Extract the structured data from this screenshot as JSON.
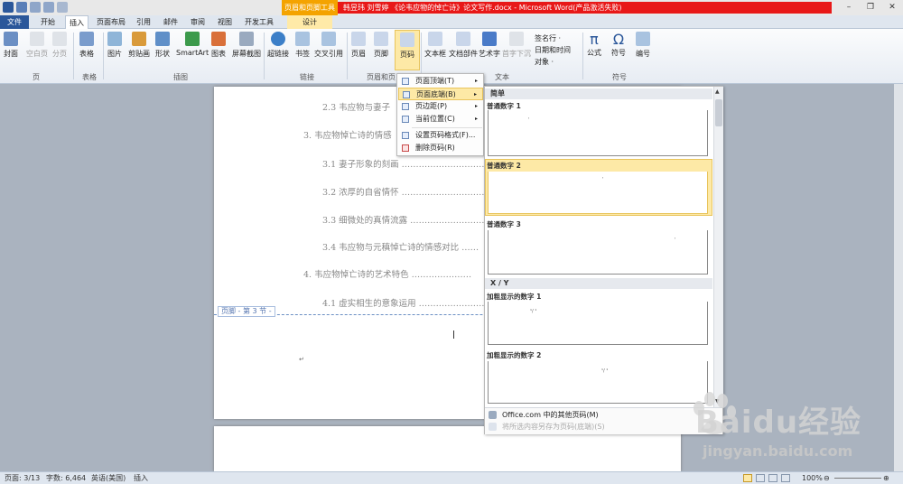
{
  "window": {
    "context_tab": "页眉和页脚工具",
    "title": "韩昱玮 刘雪婷 《论韦应物的悼亡诗》论文写作.docx - Microsoft Word(产品激活失败)"
  },
  "tabs": [
    "文件",
    "开始",
    "插入",
    "页面布局",
    "引用",
    "邮件",
    "审阅",
    "视图",
    "开发工具",
    "设计"
  ],
  "ribbon": {
    "cover": "封面",
    "blank": "空白页",
    "break": "分页",
    "table": "表格",
    "picture": "图片",
    "clipart": "剪贴画",
    "shapes": "形状",
    "smartart": "SmartArt",
    "chart": "图表",
    "screenshot": "屏幕截图",
    "hyperlink": "超链接",
    "bookmark": "书签",
    "crossref": "交叉引用",
    "header": "页眉",
    "footer": "页脚",
    "pagenum": "页码",
    "textbox": "文本框",
    "quickparts": "文档部件",
    "wordart": "艺术字",
    "dropcap": "首字下沉",
    "signature": "签名行 ·",
    "datetime": "日期和时间",
    "object": "对象 ·",
    "equation": "公式",
    "symbol": "符号",
    "number": "编号",
    "groups": {
      "pages": "页",
      "tables": "表格",
      "illus": "插图",
      "links": "链接",
      "hf": "页眉和页",
      "text": "文本",
      "symbols": "符号"
    }
  },
  "document": {
    "toc": [
      "2.3 韦应物与妻子",
      "3. 韦应物悼亡诗的情感",
      "3.1 妻子形象的刻画 ………………………………",
      "3.2 浓厚的自省情怀 ………………………………",
      "3.3 细微处的真情流露 ……………………………",
      "3.4 韦应物与元稹悼亡诗的情感对比 ……",
      "4. 韦应物悼亡诗的艺术特色 …………………",
      "4.1 虚实相生的意象运用 ……………………"
    ],
    "footer_tag": "页脚 - 第 3 节 -"
  },
  "pagenum_menu": {
    "items": [
      {
        "label": "页面顶端(T)",
        "arrow": "▸"
      },
      {
        "label": "页面底端(B)",
        "arrow": "▸"
      },
      {
        "label": "页边距(P)",
        "arrow": "▸"
      },
      {
        "label": "当前位置(C)",
        "arrow": "▸"
      },
      {
        "label": "设置页码格式(F)...",
        "arrow": ""
      },
      {
        "label": "删除页码(R)",
        "arrow": ""
      }
    ]
  },
  "gallery": {
    "section1": "简单",
    "item1": "普通数字 1",
    "item2": "普通数字 2",
    "item3": "普通数字 3",
    "section2": "X / Y",
    "item4": "加粗显示的数字 1",
    "item5": "加粗显示的数字 2",
    "num_mark": "'",
    "xy_mark": "¹/ ¹",
    "more": "Office.com 中的其他页码(M)",
    "save": "将所选内容另存为页码(底端)(S)"
  },
  "status": {
    "page": "页面: 3/13",
    "words": "字数: 6,464",
    "lang": "英语(美国)",
    "mode": "插入",
    "zoom": "100%"
  },
  "watermark": {
    "brand": "Baidu经验",
    "url": "jingyan.baidu.com"
  },
  "colors": {
    "accent": "#2b579a",
    "title_red": "#e81818",
    "context_orange": "#f4a300",
    "highlight": "#fde9a6"
  }
}
